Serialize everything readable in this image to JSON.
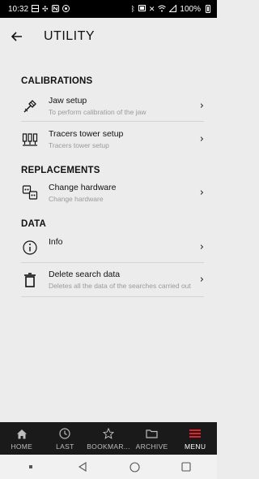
{
  "status_bar": {
    "time": "10:32",
    "battery": "100%"
  },
  "header": {
    "title": "UTILITY"
  },
  "sections": [
    {
      "title": "CALIBRATIONS",
      "items": [
        {
          "title": "Jaw setup",
          "subtitle": "To perform calibration of the jaw",
          "icon": "jaw-tool-icon"
        },
        {
          "title": "Tracers tower setup",
          "subtitle": "Tracers tower setup",
          "icon": "tracers-tower-icon"
        }
      ]
    },
    {
      "title": "REPLACEMENTS",
      "items": [
        {
          "title": "Change hardware",
          "subtitle": "Change hardware",
          "icon": "hardware-icon"
        }
      ]
    },
    {
      "title": "DATA",
      "items": [
        {
          "title": "Info",
          "subtitle": "",
          "icon": "info-icon"
        },
        {
          "title": "Delete search data",
          "subtitle": "Deletes all the data of the searches carried out",
          "icon": "trash-icon"
        }
      ]
    }
  ],
  "bottom_nav": [
    {
      "label": "HOME",
      "icon": "home-icon"
    },
    {
      "label": "LAST",
      "icon": "clock-icon"
    },
    {
      "label": "BOOKMAR...",
      "icon": "star-icon"
    },
    {
      "label": "ARCHIVE",
      "icon": "folder-icon"
    },
    {
      "label": "MENU",
      "icon": "menu-icon",
      "active": true
    }
  ],
  "colors": {
    "accent": "#e8202a",
    "background": "#ececec",
    "nav_background": "#1a1a1a"
  }
}
